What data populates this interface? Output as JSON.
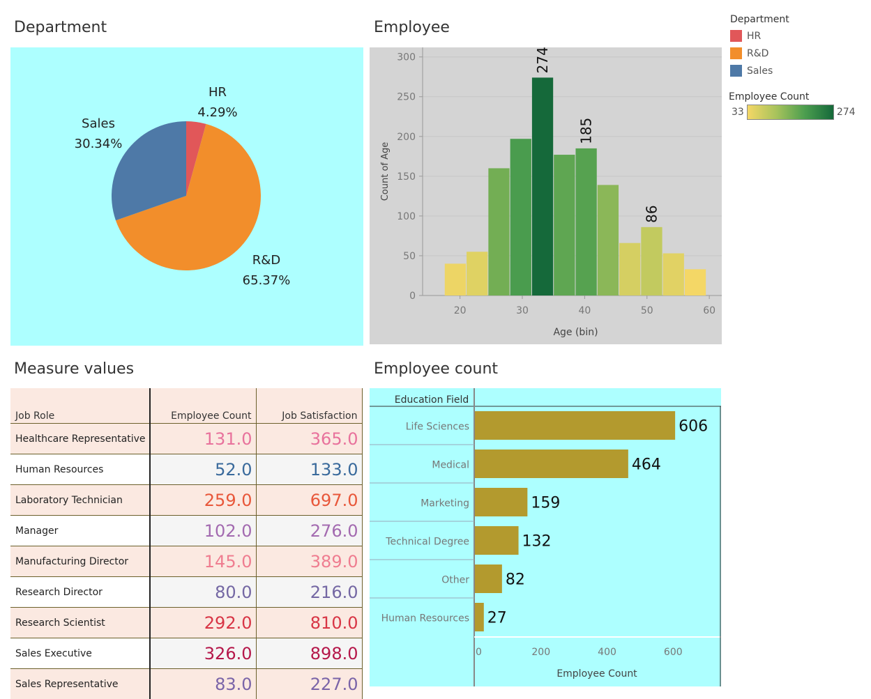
{
  "titles": {
    "department": "Department",
    "employee": "Employee",
    "measure_values": "Measure values",
    "employee_count": "Employee count"
  },
  "legend": {
    "department_title": "Department",
    "department_items": [
      {
        "label": "HR",
        "color": "#e15759"
      },
      {
        "label": "R&D",
        "color": "#f28e2b"
      },
      {
        "label": "Sales",
        "color": "#4e79a7"
      }
    ],
    "count_title": "Employee Count",
    "count_min": "33",
    "count_max": "274"
  },
  "colors": {
    "pie_panel_bg": "#adffff",
    "hist_panel_bg": "#d4d4d4",
    "bar_panel_bg": "#adffff",
    "bar_fill": "#b39a2e",
    "gradient": [
      "#f4d766",
      "#a8c35c",
      "#4c9e4f",
      "#15693a"
    ]
  },
  "chart_data": [
    {
      "id": "department_pie",
      "type": "pie",
      "title": "Department",
      "slices": [
        {
          "label": "HR",
          "value": 4.29,
          "display": "4.29%",
          "color": "#e15759"
        },
        {
          "label": "R&D",
          "value": 65.37,
          "display": "65.37%",
          "color": "#f28e2b"
        },
        {
          "label": "Sales",
          "value": 30.34,
          "display": "30.34%",
          "color": "#4e79a7"
        }
      ]
    },
    {
      "id": "age_histogram",
      "type": "bar",
      "title": "Employee",
      "xlabel": "Age (bin)",
      "ylabel": "Count of Age",
      "bin_width": 3.5,
      "bin_starts": [
        17.5,
        21,
        24.5,
        28,
        31.5,
        35,
        38.5,
        42,
        45.5,
        49,
        52.5,
        56
      ],
      "values": [
        40,
        55,
        160,
        197,
        274,
        177,
        185,
        139,
        66,
        86,
        53,
        33
      ],
      "data_labels": [
        {
          "index": 4,
          "text": "274"
        },
        {
          "index": 6,
          "text": "185"
        },
        {
          "index": 9,
          "text": "86"
        }
      ],
      "xlim": [
        14,
        62
      ],
      "ylim": [
        0,
        312
      ],
      "x_ticks": [
        "20",
        "30",
        "40",
        "50",
        "60"
      ],
      "y_ticks": [
        "0",
        "50",
        "100",
        "150",
        "200",
        "250",
        "300"
      ],
      "color_range": [
        33,
        274
      ],
      "grid": true
    },
    {
      "id": "job_role_table",
      "type": "table",
      "title": "Measure values",
      "columns": [
        "Job Role",
        "Employee Count",
        "Job Satisfaction"
      ],
      "rows": [
        {
          "role": "Healthcare Representative",
          "count": "131.0",
          "satisfaction": "365.0",
          "color": "#e8729c"
        },
        {
          "role": "Human Resources",
          "count": "52.0",
          "satisfaction": "133.0",
          "color": "#3a6a9c"
        },
        {
          "role": "Laboratory Technician",
          "count": "259.0",
          "satisfaction": "697.0",
          "color": "#e8573a"
        },
        {
          "role": "Manager",
          "count": "102.0",
          "satisfaction": "276.0",
          "color": "#a36ab0"
        },
        {
          "role": "Manufacturing Director",
          "count": "145.0",
          "satisfaction": "389.0",
          "color": "#ef7d90"
        },
        {
          "role": "Research Director",
          "count": "80.0",
          "satisfaction": "216.0",
          "color": "#7467a3"
        },
        {
          "role": "Research Scientist",
          "count": "292.0",
          "satisfaction": "810.0",
          "color": "#d83545"
        },
        {
          "role": "Sales Executive",
          "count": "326.0",
          "satisfaction": "898.0",
          "color": "#b5174a"
        },
        {
          "role": "Sales Representative",
          "count": "83.0",
          "satisfaction": "227.0",
          "color": "#7a64a8"
        }
      ]
    },
    {
      "id": "education_bar",
      "type": "bar",
      "orientation": "horizontal",
      "title": "Employee count",
      "row_header": "Education Field",
      "xlabel": "Employee Count",
      "categories": [
        "Life Sciences",
        "Medical",
        "Marketing",
        "Technical Degree",
        "Other",
        "Human Resources"
      ],
      "values": [
        606,
        464,
        159,
        132,
        82,
        27
      ],
      "xlim": [
        0,
        745
      ],
      "x_ticks": [
        "0",
        "200",
        "400",
        "600"
      ]
    }
  ]
}
